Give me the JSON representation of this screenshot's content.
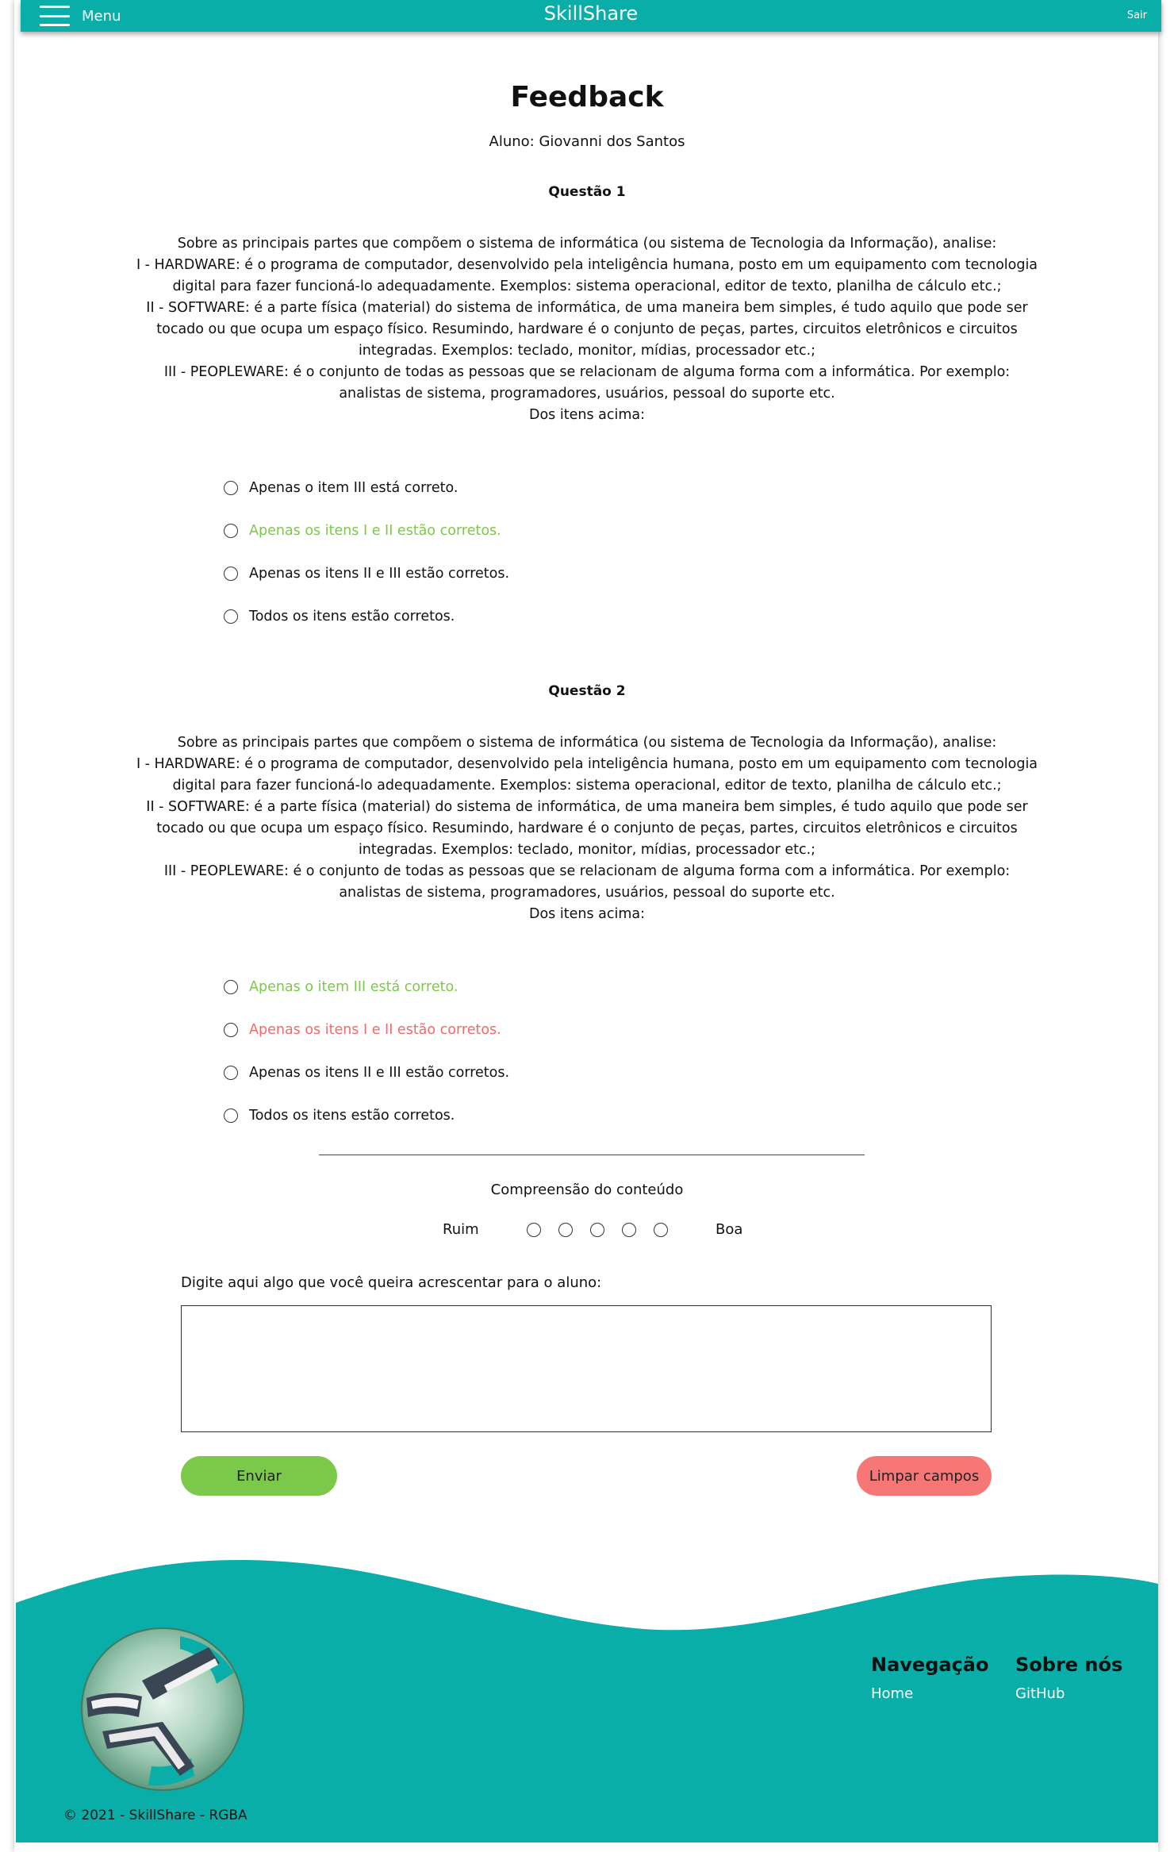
{
  "header": {
    "menu_label": "Menu",
    "brand": "SkillShare",
    "logout_label": "Sair",
    "bar_color": "#0aaea9"
  },
  "page": {
    "title": "Feedback",
    "student": "Aluno: Giovanni dos Santos"
  },
  "questions": [
    {
      "title": "Questão 1",
      "text": "Sobre as principais partes que compõem o sistema de informática (ou sistema de Tecnologia da Informação), analise:\nI - HARDWARE: é o programa de computador, desenvolvido pela inteligência humana, posto em um equipamento com tecnologia digital para fazer funcioná-lo adequadamente. Exemplos: sistema operacional, editor de texto, planilha de cálculo etc.;\nII - SOFTWARE: é a parte física (material) do sistema de informática, de uma maneira bem simples, é tudo aquilo que pode ser tocado ou que ocupa um espaço físico. Resumindo, hardware é o conjunto de peças, partes, circuitos eletrônicos e circuitos integradas. Exemplos: teclado, monitor, mídias, processador etc.;\nIII - PEOPLEWARE: é o conjunto de todas as pessoas que se relacionam de alguma forma com a informática. Por exemplo: analistas de sistema, programadores, usuários, pessoal do suporte etc.\nDos itens acima:",
      "options": [
        {
          "label": "Apenas o item III está correto.",
          "status": "neutral"
        },
        {
          "label": "Apenas os itens I e II estão corretos.",
          "status": "correct"
        },
        {
          "label": "Apenas os itens II e III estão corretos.",
          "status": "neutral"
        },
        {
          "label": "Todos os itens estão corretos.",
          "status": "neutral"
        }
      ]
    },
    {
      "title": "Questão 2",
      "text": "Sobre as principais partes que compõem o sistema de informática (ou sistema de Tecnologia da Informação), analise:\nI - HARDWARE: é o programa de computador, desenvolvido pela inteligência humana, posto em um equipamento com tecnologia digital para fazer funcioná-lo adequadamente. Exemplos: sistema operacional, editor de texto, planilha de cálculo etc.;\nII - SOFTWARE: é a parte física (material) do sistema de informática, de uma maneira bem simples, é tudo aquilo que pode ser tocado ou que ocupa um espaço físico. Resumindo, hardware é o conjunto de peças, partes, circuitos eletrônicos e circuitos integradas. Exemplos: teclado, monitor, mídias, processador etc.;\nIII - PEOPLEWARE: é o conjunto de todas as pessoas que se relacionam de alguma forma com a informática. Por exemplo: analistas de sistema, programadores, usuários, pessoal do suporte etc.\nDos itens acima:",
      "options": [
        {
          "label": "Apenas o item III está correto.",
          "status": "correct"
        },
        {
          "label": "Apenas os itens I e II estão corretos.",
          "status": "wrong"
        },
        {
          "label": "Apenas os itens II e III estão corretos.",
          "status": "neutral"
        },
        {
          "label": "Todos os itens estão corretos.",
          "status": "neutral"
        }
      ]
    }
  ],
  "rating": {
    "title": "Compreensão do conteúdo",
    "low_label": "Ruim",
    "high_label": "Boa",
    "scale_count": 5
  },
  "comment": {
    "label": "Digite aqui algo que você queira acrescentar para o aluno:",
    "value": ""
  },
  "actions": {
    "send_label": "Enviar",
    "clear_label": "Limpar campos",
    "send_color": "#7cc84a",
    "clear_color": "#f77777"
  },
  "colors": {
    "correct": "#7cc84a",
    "wrong": "#f06a6a",
    "footer": "#0aaea9"
  },
  "footer": {
    "nav_heading": "Navegação",
    "nav_links": [
      "Home"
    ],
    "about_heading": "Sobre nós",
    "about_links": [
      "GitHub"
    ],
    "copyright": "© 2021 - SkillShare - RGBA",
    "logo_icon": "skillshare-logo-icon"
  }
}
